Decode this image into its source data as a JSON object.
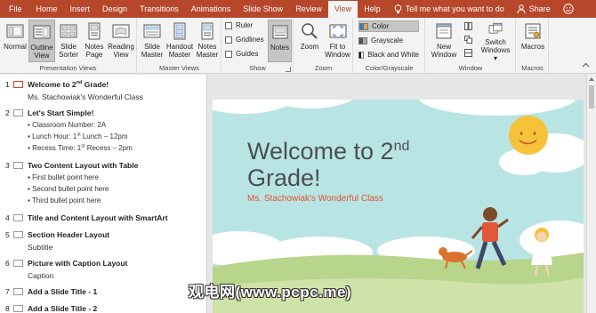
{
  "tabs": {
    "file": "File",
    "home": "Home",
    "insert": "Insert",
    "design": "Design",
    "transitions": "Transitions",
    "animations": "Animations",
    "slideshow": "Slide Show",
    "review": "Review",
    "view": "View",
    "help": "Help"
  },
  "tellme": "Tell me what you want to do",
  "share": "Share",
  "ribbon": {
    "presentation_views": {
      "label": "Presentation Views",
      "normal": "Normal",
      "outline_1": "Outline",
      "outline_2": "View",
      "slide_sorter_1": "Slide",
      "slide_sorter_2": "Sorter",
      "notes_page_1": "Notes",
      "notes_page_2": "Page",
      "reading_view_1": "Reading",
      "reading_view_2": "View"
    },
    "master_views": {
      "label": "Master Views",
      "slide_master_1": "Slide",
      "slide_master_2": "Master",
      "handout_master_1": "Handout",
      "handout_master_2": "Master",
      "notes_master_1": "Notes",
      "notes_master_2": "Master"
    },
    "show": {
      "label": "Show",
      "ruler": "Ruler",
      "gridlines": "Gridlines",
      "guides": "Guides",
      "notes": "Notes"
    },
    "zoom": {
      "label": "Zoom",
      "zoom": "Zoom",
      "fit_1": "Fit to",
      "fit_2": "Window"
    },
    "color": {
      "label": "Color/Grayscale",
      "color": "Color",
      "grayscale": "Grayscale",
      "bw": "Black and White"
    },
    "window": {
      "label": "Window",
      "new_1": "New",
      "new_2": "Window",
      "switch_1": "Switch",
      "switch_2": "Windows"
    },
    "macros": {
      "label": "Macros",
      "macros": "Macros"
    }
  },
  "outline": {
    "s1": {
      "num": "1",
      "title_a": "Welcome to 2",
      "title_sup": "nd",
      "title_b": " Grade!",
      "sub": "Ms. Stachowiak's Wonderful Class"
    },
    "s2": {
      "num": "2",
      "title": "Let's Start Simple!",
      "b1": "Classroom Number: 2A",
      "b2a": "Lunch Hour: 1",
      "b2sup": "st",
      "b2b": " Lunch – 12pm",
      "b3a": "Recess Time: 1",
      "b3sup": "st",
      "b3b": " Recess – 2pm"
    },
    "s3": {
      "num": "3",
      "title": "Two Content Layout with Table",
      "b1": "First bullet point here",
      "b2": "Second bullet point here",
      "b3": "Third bullet point here"
    },
    "s4": {
      "num": "4",
      "title": "Title and Content Layout with SmartArt"
    },
    "s5": {
      "num": "5",
      "title": "Section Header Layout",
      "sub": "Subtitle"
    },
    "s6": {
      "num": "6",
      "title": "Picture with Caption Layout",
      "sub": "Caption"
    },
    "s7": {
      "num": "7",
      "title": "Add a Slide Title - 1"
    },
    "s8": {
      "num": "8",
      "title": "Add a Slide Title - 2"
    }
  },
  "slide": {
    "title_a": "Welcome to 2",
    "title_sup": "nd",
    "title_b": "Grade!",
    "subtitle": "Ms. Stachowiak's Wonderful Class"
  },
  "watermark": "观电网(www.pcpc.me)",
  "colors": {
    "accent": "#b7472a",
    "slide_sky": "#b9e4e4",
    "slide_grass": "#b7d58b",
    "subtitle": "#e0522f"
  }
}
